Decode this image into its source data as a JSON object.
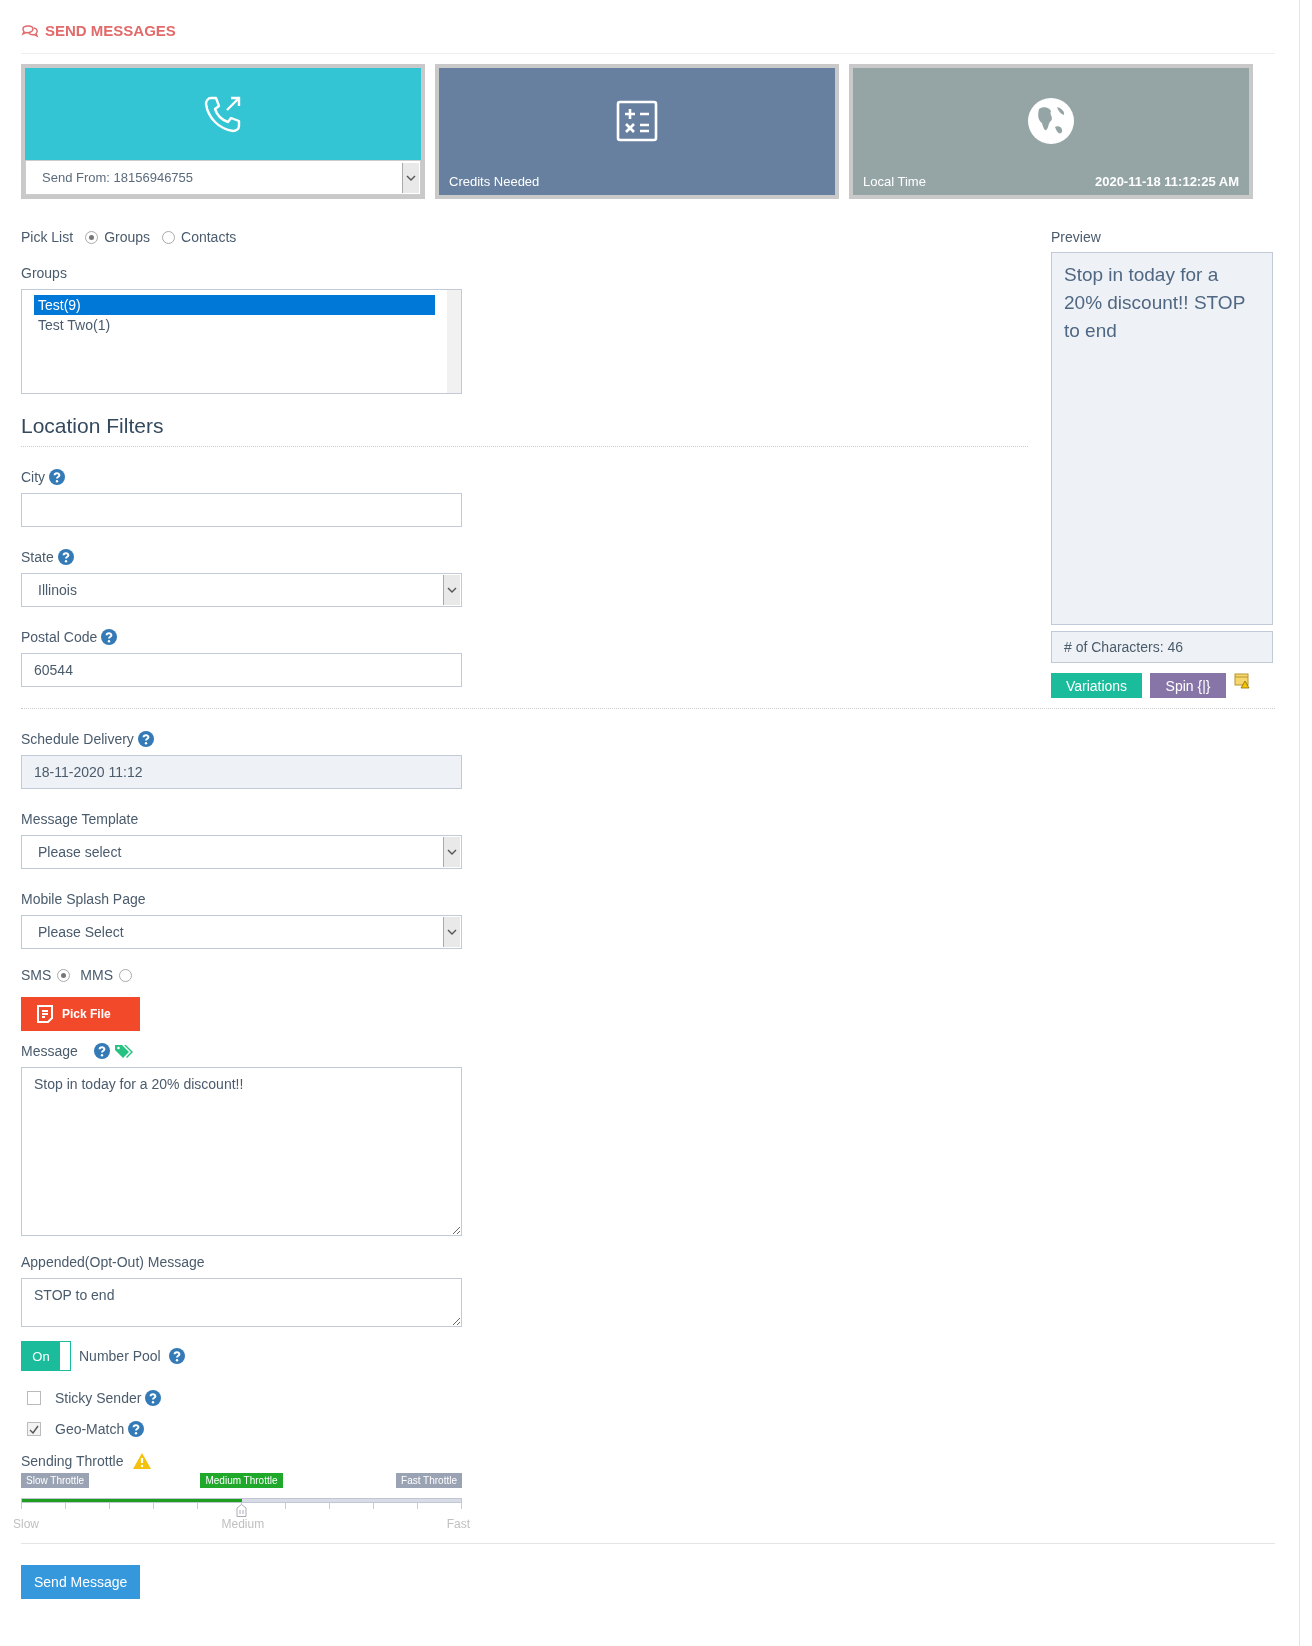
{
  "header": {
    "title": "SEND MESSAGES"
  },
  "tiles": [
    {
      "kind": "phone",
      "select_value": "Send From: 18156946755"
    },
    {
      "kind": "calculator",
      "label": "Credits Needed"
    },
    {
      "kind": "globe",
      "label": "Local Time",
      "value": "2020-11-18 11:12:25 AM"
    }
  ],
  "pick_list": {
    "label": "Pick List",
    "options": [
      {
        "label": "Groups",
        "selected": true
      },
      {
        "label": "Contacts",
        "selected": false
      }
    ]
  },
  "groups": {
    "label": "Groups",
    "items": [
      {
        "label": "Test(9)",
        "selected": true
      },
      {
        "label": "Test Two(1)",
        "selected": false
      }
    ]
  },
  "location_filters": {
    "title": "Location Filters",
    "fields": [
      {
        "kind": "input",
        "label": "City",
        "help": true
      },
      {
        "kind": "select",
        "label": "State",
        "help": true,
        "value": "Illinois"
      },
      {
        "kind": "input",
        "label": "Postal Code",
        "help": true,
        "value": "60544"
      }
    ]
  },
  "preview": {
    "label": "Preview",
    "text": "Stop in today for a 20% discount!! STOP to end",
    "char_count": "# of Characters: 46",
    "buttons": [
      {
        "kind": "variations",
        "label": "Variations"
      },
      {
        "kind": "spin",
        "label": "Spin {|}"
      }
    ]
  },
  "fields": [
    {
      "kind": "input",
      "label": "Schedule Delivery",
      "help": true,
      "value": "18-11-2020 11:12",
      "disabled": true
    },
    {
      "kind": "select",
      "label": "Message Template",
      "value": "Please select"
    },
    {
      "kind": "select",
      "label": "Mobile Splash Page",
      "value": "Please Select"
    }
  ],
  "message_type": {
    "options": [
      {
        "label": "SMS",
        "selected": true
      },
      {
        "label": "MMS",
        "selected": false
      }
    ]
  },
  "pick_file": {
    "label": "Pick File"
  },
  "message": {
    "label": "Message",
    "help": true,
    "value": "Stop in today for a 20% discount!!"
  },
  "appended": {
    "label": "Appended(Opt-Out) Message",
    "value": "STOP to end"
  },
  "number_pool": {
    "toggle_label": "On",
    "on": true,
    "label": "Number Pool",
    "help": true
  },
  "checkboxes": [
    {
      "label": "Sticky Sender",
      "checked": false,
      "help": true
    },
    {
      "label": "Geo-Match",
      "checked": true,
      "help": true
    }
  ],
  "throttle": {
    "label": "Sending Throttle",
    "warning": true,
    "marks": [
      {
        "label": "Slow Throttle",
        "selected": false
      },
      {
        "label": "Medium Throttle",
        "selected": true
      },
      {
        "label": "Fast Throttle",
        "selected": false
      }
    ],
    "level": 0.5,
    "scale": [
      "Slow",
      "Medium",
      "Fast"
    ]
  },
  "send_button": {
    "label": "Send Message"
  }
}
